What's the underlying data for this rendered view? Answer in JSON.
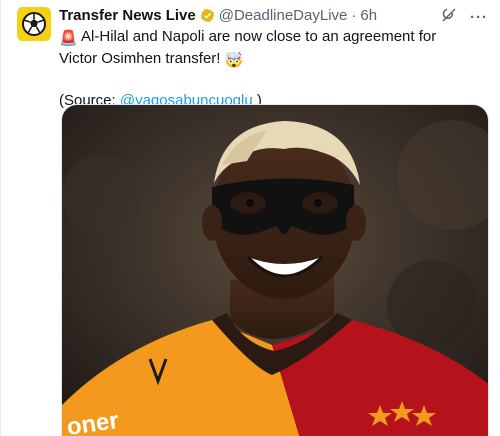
{
  "account": {
    "display_name": "Transfer News Live",
    "handle": "@DeadlineDayLive",
    "separator": "·",
    "time": "6h",
    "avatar_icon": "football-icon",
    "verified_icon": "verified-badge-icon"
  },
  "tweet": {
    "text_main": "Al-Hilal and Napoli are now close to an agreement for Victor Osimhen transfer!",
    "source_prefix": "(Source: ",
    "source_mention": "@yagosabuncuoglu",
    "source_suffix": " )",
    "leading_emoji": "🚨",
    "trailing_emoji": "🤯"
  },
  "actions": {
    "grok_icon": "grok-icon",
    "more_label": "···"
  },
  "media": {
    "jersey_text": "oner"
  },
  "colors": {
    "accent": "#1d9bf0",
    "avatar_bg": "#f5d116",
    "jersey_orange": "#f39a1e",
    "jersey_red": "#b5121b"
  }
}
